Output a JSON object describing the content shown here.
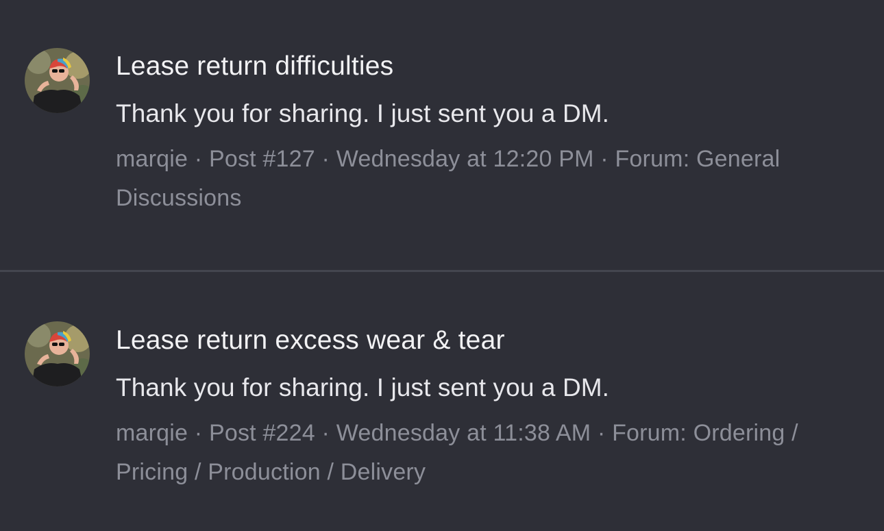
{
  "results": [
    {
      "avatar_icon": "user-avatar-photo",
      "title": "Lease return difficulties",
      "snippet": "Thank you for sharing. I just sent you a DM.",
      "author": "marqie",
      "post": "Post #127",
      "time": "Wednesday at 12:20 PM",
      "forum": "Forum: General Discussions"
    },
    {
      "avatar_icon": "user-avatar-photo",
      "title": "Lease return excess wear & tear",
      "snippet": "Thank you for sharing. I just sent you a DM.",
      "author": "marqie",
      "post": "Post #224",
      "time": "Wednesday at 11:38 AM",
      "forum": "Forum: Ordering / Pricing / Production / Delivery"
    }
  ],
  "colors": {
    "background": "#2e2f37",
    "divider": "#44464f",
    "title": "#f2f2f4",
    "meta": "#8d8f99"
  }
}
